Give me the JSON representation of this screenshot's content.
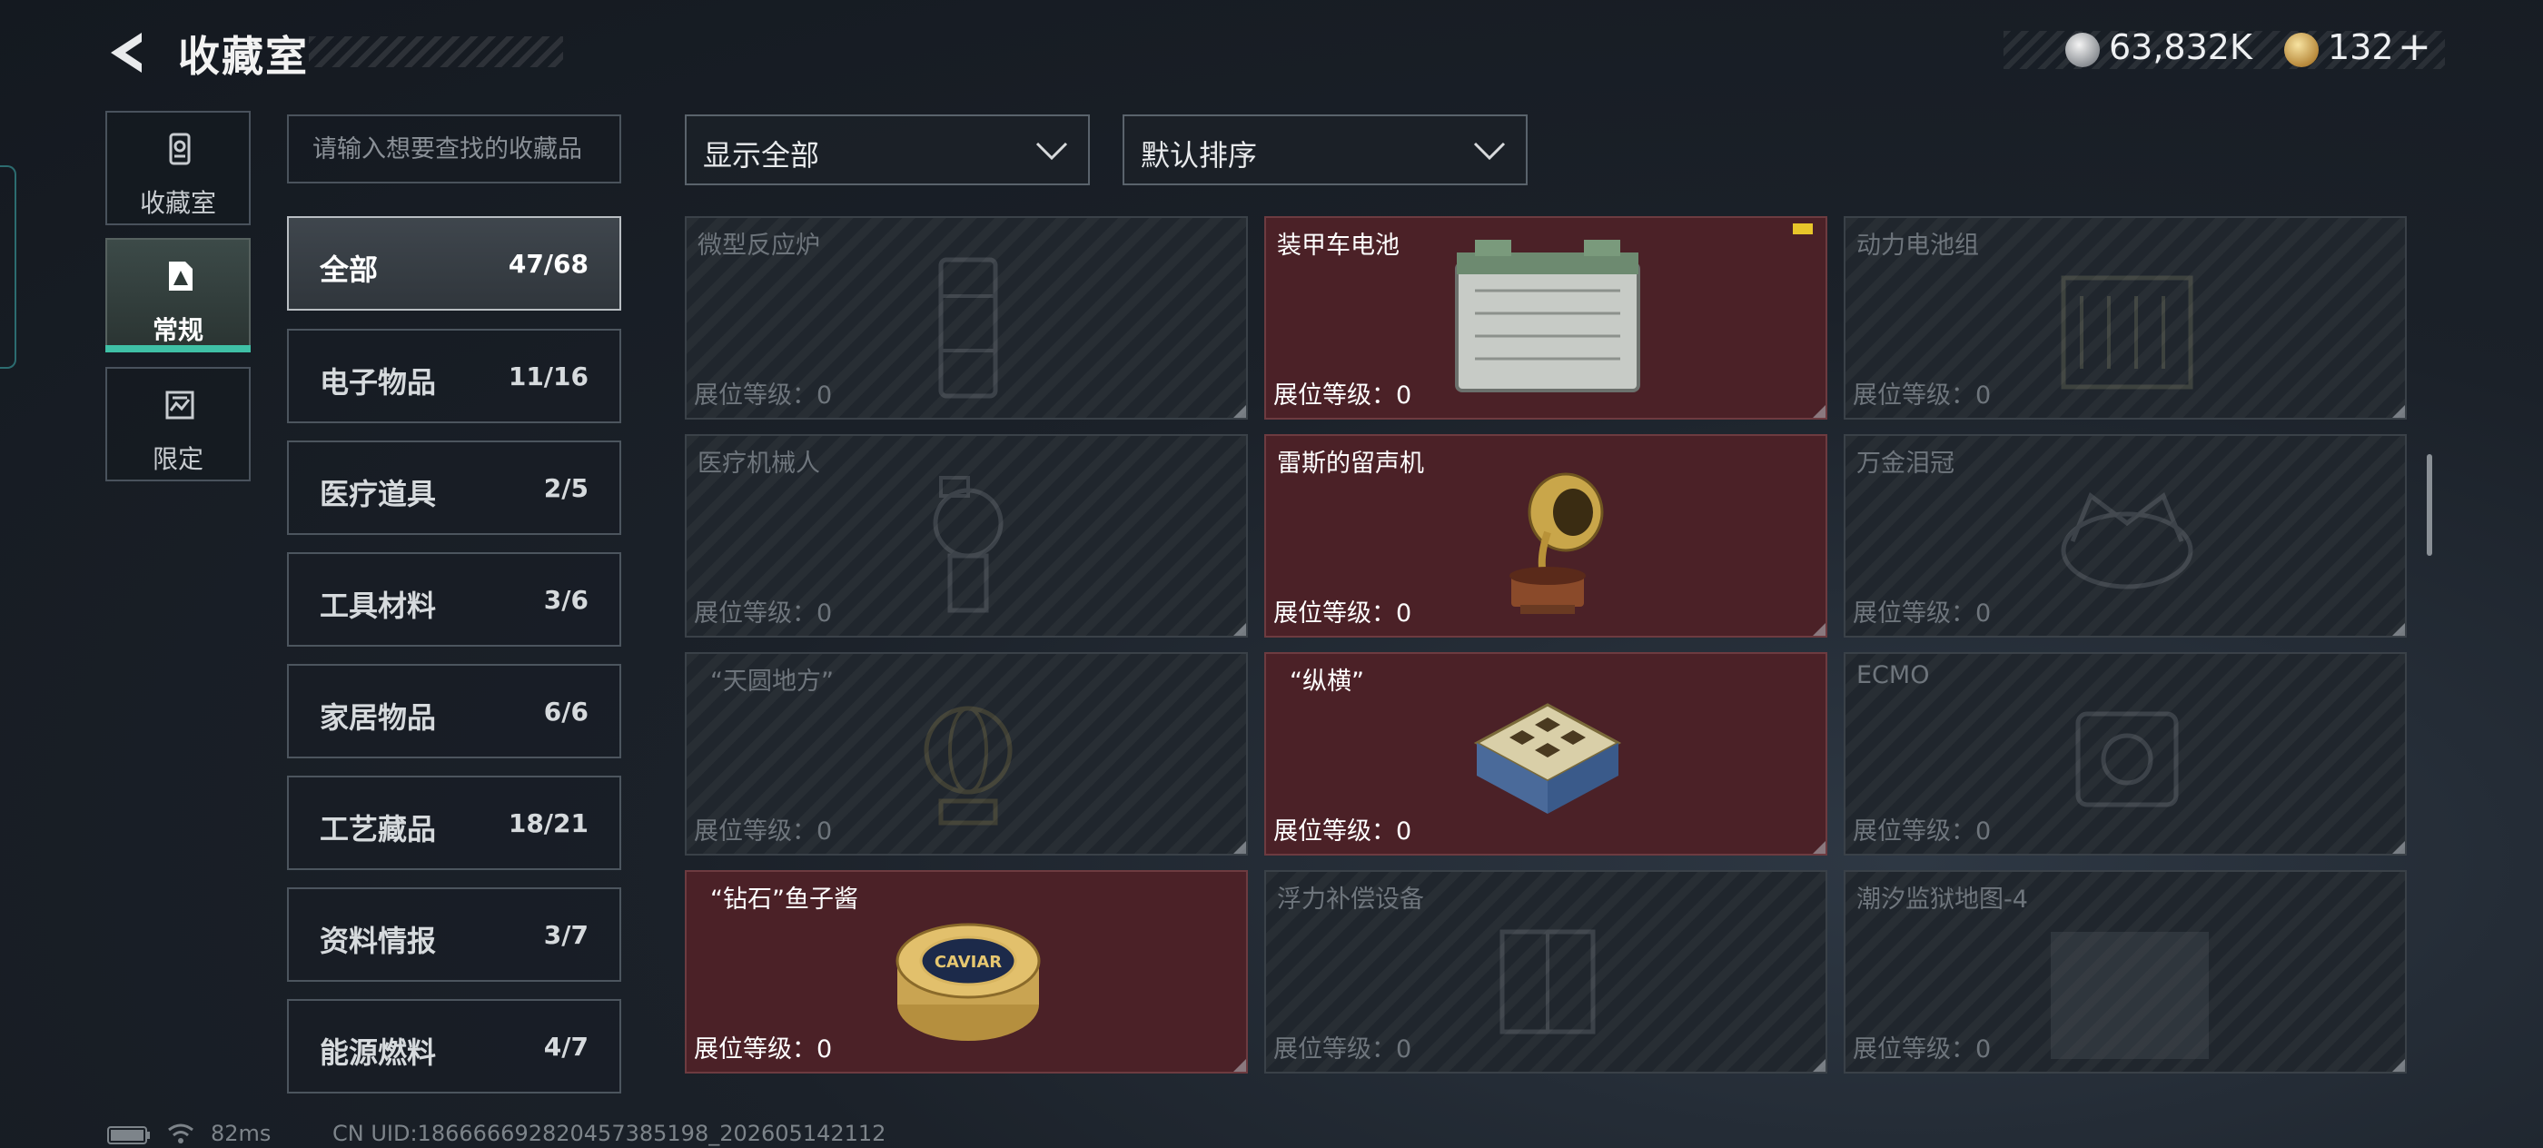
{
  "header": {
    "title": "收藏室",
    "currency_silver": "63,832K",
    "currency_gold": "132",
    "add_symbol": "+"
  },
  "sidebar": {
    "tabs": [
      {
        "label": "收藏室",
        "icon": "collection-icon"
      },
      {
        "label": "常规",
        "icon": "regular-icon",
        "active": true
      },
      {
        "label": "限定",
        "icon": "limited-icon"
      }
    ]
  },
  "search": {
    "placeholder": "请输入想要查找的收藏品"
  },
  "filters": {
    "display": "显示全部",
    "sort": "默认排序"
  },
  "categories": [
    {
      "name": "全部",
      "count": "47/68",
      "active": true
    },
    {
      "name": "电子物品",
      "count": "11/16"
    },
    {
      "name": "医疗道具",
      "count": "2/5"
    },
    {
      "name": "工具材料",
      "count": "3/6"
    },
    {
      "name": "家居物品",
      "count": "6/6"
    },
    {
      "name": "工艺藏品",
      "count": "18/21"
    },
    {
      "name": "资料情报",
      "count": "3/7"
    },
    {
      "name": "能源燃料",
      "count": "4/7"
    }
  ],
  "items": [
    {
      "name": "微型反应炉",
      "level": "展位等级：0",
      "owned": false
    },
    {
      "name": "装甲车电池",
      "level": "展位等级：0",
      "owned": true
    },
    {
      "name": "动力电池组",
      "level": "展位等级：0",
      "owned": false
    },
    {
      "name": "医疗机械人",
      "level": "展位等级：0",
      "owned": false
    },
    {
      "name": "雷斯的留声机",
      "level": "展位等级：0",
      "owned": true
    },
    {
      "name": "万金泪冠",
      "level": "展位等级：0",
      "owned": false
    },
    {
      "name": "“天圆地方”",
      "level": "展位等级：0",
      "owned": false
    },
    {
      "name": "“纵横”",
      "level": "展位等级：0",
      "owned": true
    },
    {
      "name": "ECMO",
      "level": "展位等级：0",
      "owned": false
    },
    {
      "name": "“钻石”鱼子酱",
      "level": "展位等级：0",
      "owned": true
    },
    {
      "name": "浮力补偿设备",
      "level": "展位等级：0",
      "owned": false
    },
    {
      "name": "潮汐监狱地图-4",
      "level": "展位等级：0",
      "owned": false
    }
  ],
  "caviar_label": "CAVIAR",
  "footer": {
    "ping": "82ms",
    "uid": "CN UID:186666692820457385198_202605142112"
  },
  "colors": {
    "accent": "#3fc0a6",
    "owned_card": "#4b2127",
    "locked_card": "#20262d"
  }
}
